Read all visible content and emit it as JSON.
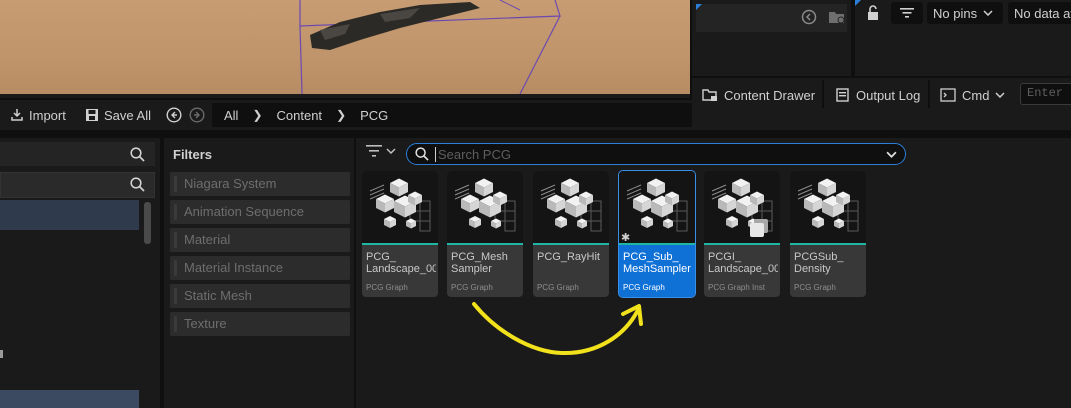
{
  "top_right": {
    "pins_label": "No pins",
    "data_label": "No data av"
  },
  "drawer_bar": {
    "content_drawer": "Content Drawer",
    "output_log": "Output Log",
    "cmd": "Cmd",
    "console_placeholder": "Enter Console Command"
  },
  "toolbar": {
    "import": "Import",
    "save_all": "Save All",
    "breadcrumb": [
      "All",
      "Content",
      "PCG"
    ]
  },
  "filters": {
    "title": "Filters",
    "items": [
      "Niagara System",
      "Animation Sequence",
      "Material",
      "Material Instance",
      "Static Mesh",
      "Texture"
    ]
  },
  "search": {
    "placeholder": "Search PCG"
  },
  "assets": [
    {
      "name": "PCG_\nLandscape_00",
      "type": "PCG Graph",
      "selected": false
    },
    {
      "name": "PCG_Mesh\nSampler",
      "type": "PCG Graph",
      "selected": false
    },
    {
      "name": "PCG_RayHit",
      "type": "PCG Graph",
      "selected": false
    },
    {
      "name": "PCG_Sub_\nMeshSampler",
      "type": "PCG Graph",
      "selected": true
    },
    {
      "name": "PCGI_\nLandscape_00",
      "type": "PCG Graph Inst",
      "selected": false
    },
    {
      "name": "PCGSub_\nDensity",
      "type": "PCG Graph",
      "selected": false
    }
  ],
  "colors": {
    "accent": "#0f71d6",
    "pcg_bar": "#1fb6a3",
    "annotation_arrow": "#f2e21c"
  }
}
